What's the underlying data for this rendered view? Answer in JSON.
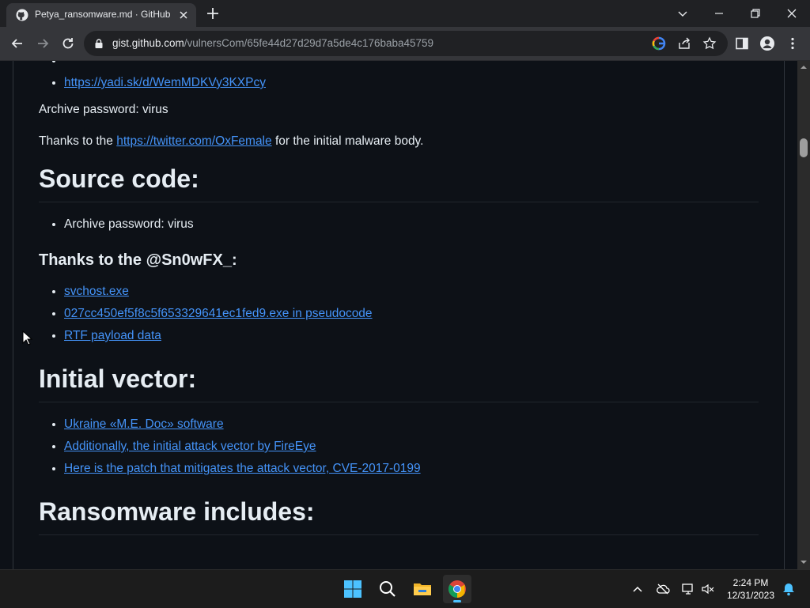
{
  "browser": {
    "tab_title": "Petya_ransomware.md · GitHub",
    "url_host": "gist.github.com",
    "url_path": "/vulnersCom/65fe44d27d29d7a5de4c176baba45759"
  },
  "page": {
    "top_links": [
      "https://yadi.sk/d/WemMDKVy3KXPcy"
    ],
    "archive_password_1": "Archive password: virus",
    "thanks_prefix": "Thanks to the ",
    "thanks_link": "https://twitter.com/OxFemale",
    "thanks_suffix": " for the initial malware body.",
    "section_source": "Source code:",
    "source_items": [
      "Archive password: virus"
    ],
    "thanks_snow": "Thanks to the @Sn0wFX_:",
    "snow_links": [
      "svchost.exe",
      "027cc450ef5f8c5f653329641ec1fed9.exe in pseudocode",
      "RTF payload data"
    ],
    "section_vector": "Initial vector:",
    "vector_links": [
      "Ukraine «M.E. Doc» software",
      "Additionally, the initial attack vector by FireEye",
      "Here is the patch that mitigates the attack vector, CVE-2017-0199"
    ],
    "section_ransom": "Ransomware includes:"
  },
  "taskbar": {
    "time": "2:24 PM",
    "date": "12/31/2023"
  },
  "colors": {
    "link": "#4493f8",
    "page_bg": "#0d1117",
    "accent": "#4cc2ff"
  }
}
